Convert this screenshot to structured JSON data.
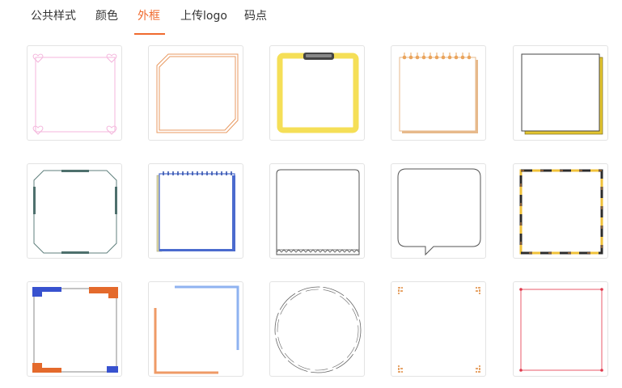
{
  "tabs": [
    {
      "label": "公共样式",
      "active": false
    },
    {
      "label": "颜色",
      "active": false
    },
    {
      "label": "外框",
      "active": true
    },
    {
      "label": "上传logo",
      "active": false
    },
    {
      "label": "码点",
      "active": false
    }
  ],
  "accent_color": "#f06a2e",
  "frames": [
    {
      "icon": "pink-heart-corner-frame-icon"
    },
    {
      "icon": "orange-clipped-corner-frame-icon"
    },
    {
      "icon": "yellow-clipboard-frame-icon"
    },
    {
      "icon": "spiral-notebook-frame-icon"
    },
    {
      "icon": "yellow-shadow-frame-icon"
    },
    {
      "icon": "teal-octagon-bracket-frame-icon"
    },
    {
      "icon": "blue-spiral-notebook-frame-icon"
    },
    {
      "icon": "gray-zigzag-bottom-frame-icon"
    },
    {
      "icon": "speech-bubble-frame-icon"
    },
    {
      "icon": "yellow-black-dashed-frame-icon"
    },
    {
      "icon": "blue-orange-corner-block-frame-icon"
    },
    {
      "icon": "blue-orange-offset-corner-frame-icon"
    },
    {
      "icon": "dashed-circle-frame-icon"
    },
    {
      "icon": "orange-small-corner-frame-icon"
    },
    {
      "icon": "red-thin-dot-corner-frame-icon"
    }
  ]
}
